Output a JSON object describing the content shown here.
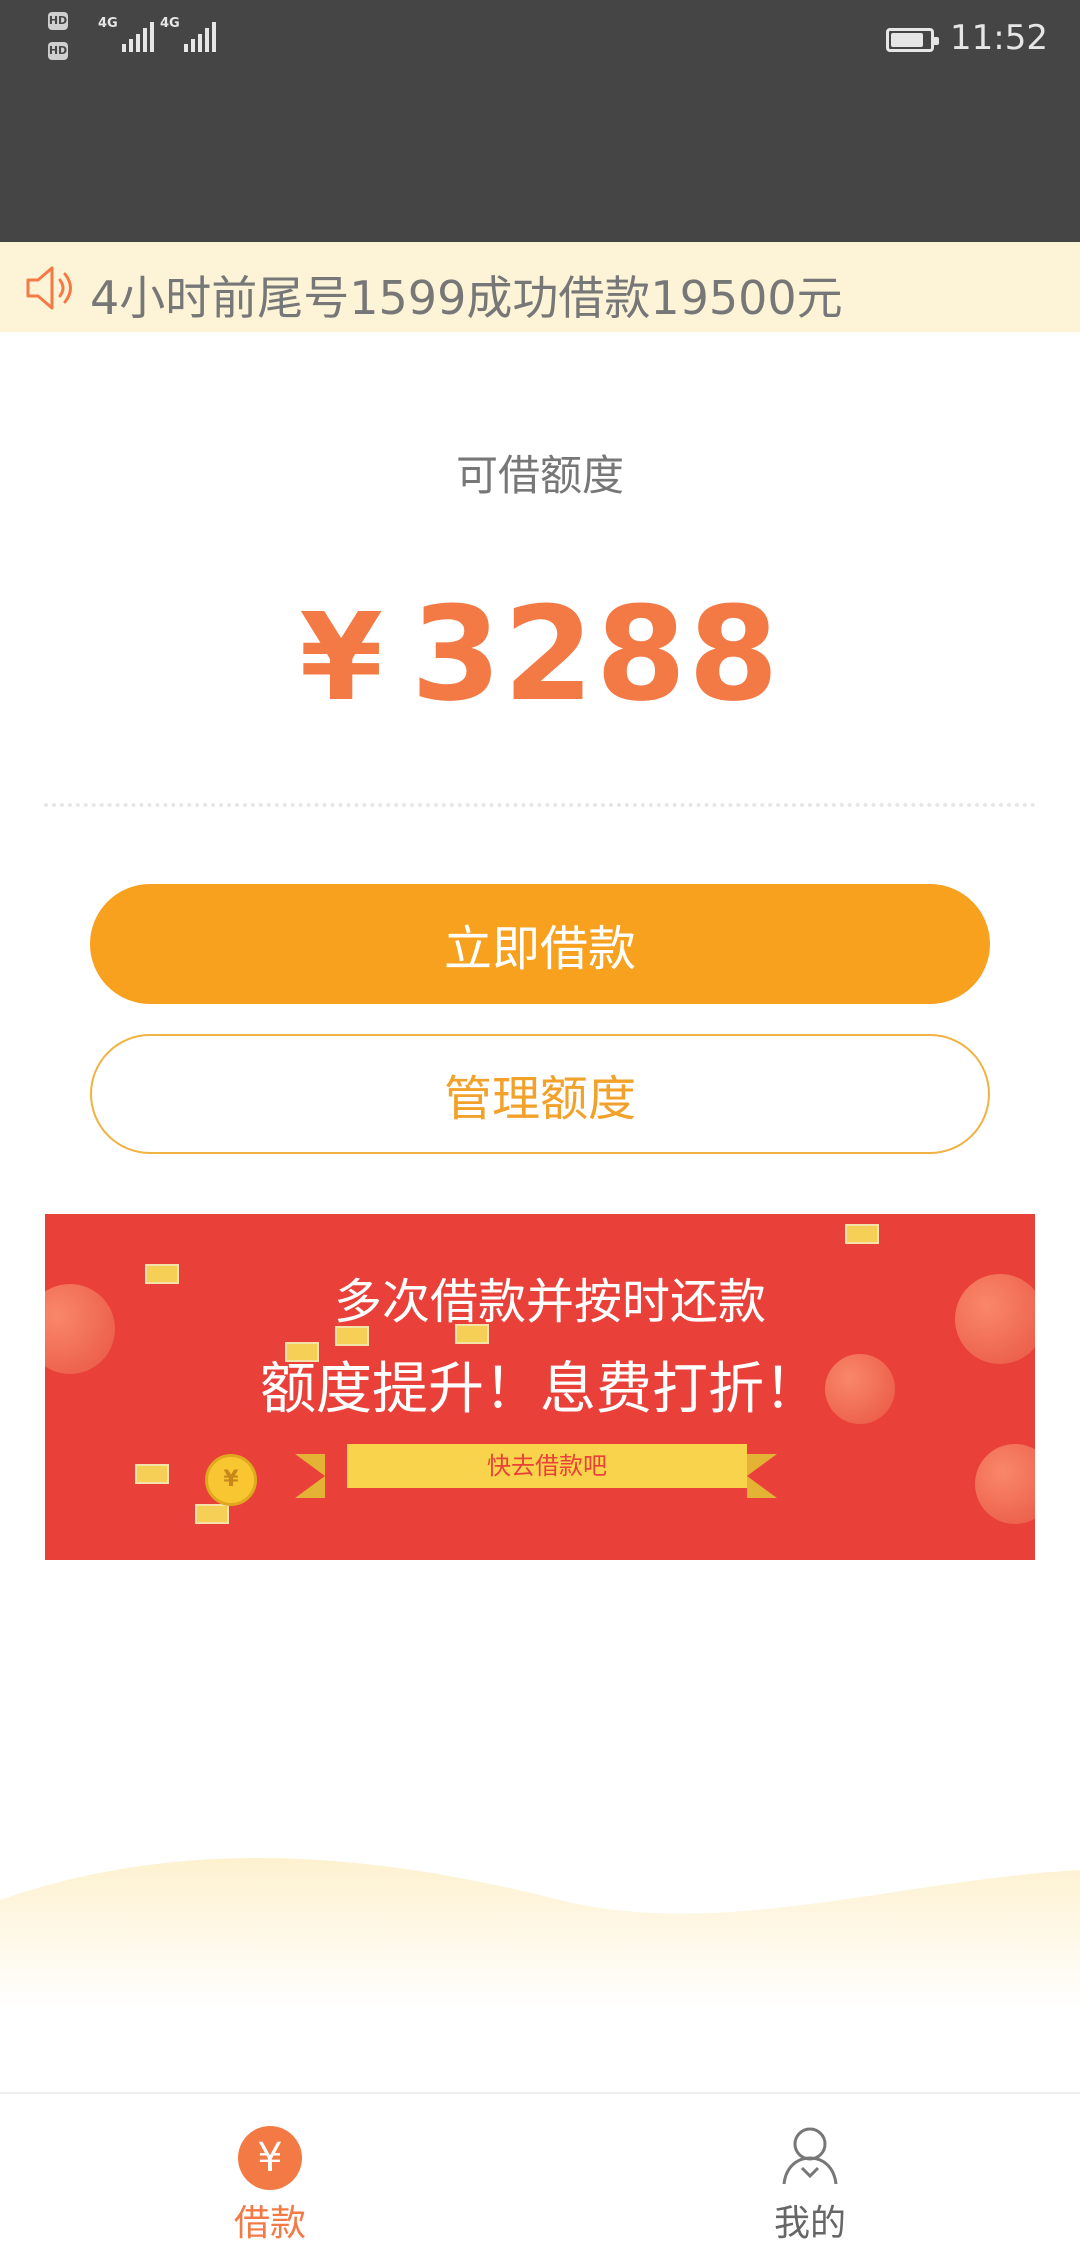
{
  "status_bar": {
    "sim1_badge": "HD",
    "sim2_badge": "HD",
    "network1": "4G",
    "network2": "4G",
    "time": "11:52"
  },
  "notice": {
    "icon": "speaker-icon",
    "text": "4小时前尾号1599成功借款19500元"
  },
  "credit": {
    "label": "可借额度",
    "currency": "¥",
    "amount": "3288"
  },
  "buttons": {
    "borrow_now": "立即借款",
    "manage_credit": "管理额度"
  },
  "banner": {
    "line1": "多次借款并按时还款",
    "line2": "额度提升！息费打折！",
    "ribbon": "快去借款吧"
  },
  "bottom_nav": {
    "items": [
      {
        "label": "借款",
        "icon": "yen-icon",
        "active": true
      },
      {
        "label": "我的",
        "icon": "user-icon",
        "active": false
      }
    ]
  },
  "colors": {
    "accent_orange": "#f47a45",
    "button_orange": "#f8a11e",
    "banner_red": "#e9403a",
    "notice_bg": "#fdf4d8",
    "status_bar": "#454545"
  }
}
